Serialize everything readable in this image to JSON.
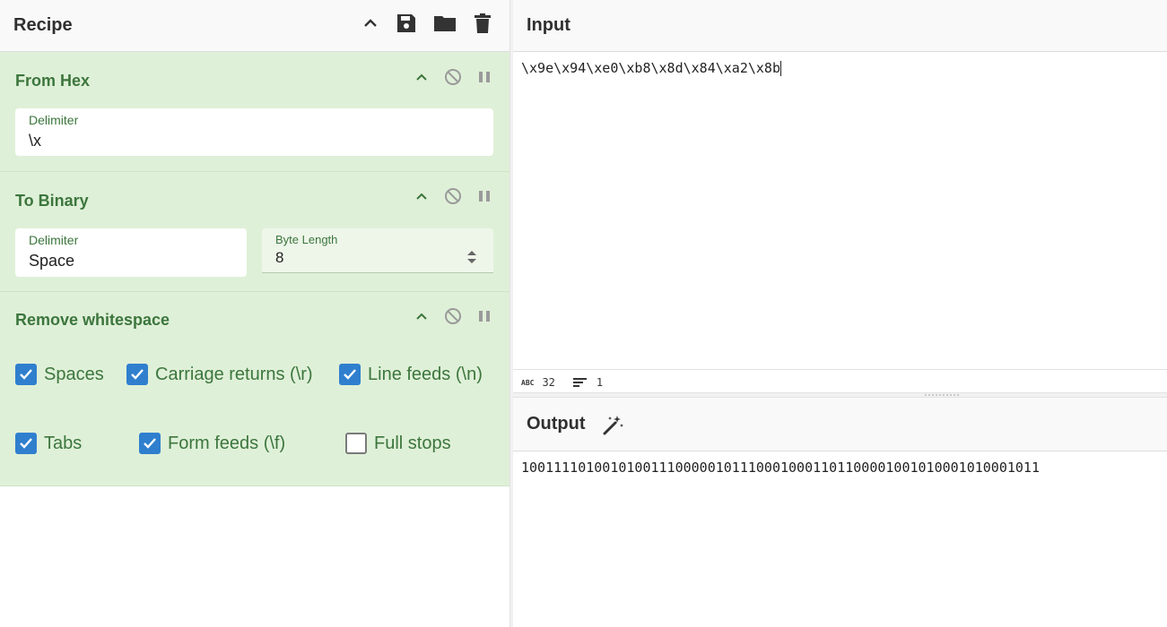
{
  "recipe": {
    "title": "Recipe",
    "tools": [
      "chevron-up-icon",
      "save-icon",
      "folder-icon",
      "trash-icon"
    ],
    "operations": [
      {
        "name": "From Hex",
        "fields": [
          {
            "label": "Delimiter",
            "value": "\\x"
          }
        ]
      },
      {
        "name": "To Binary",
        "fields": [
          {
            "label": "Delimiter",
            "value": "Space"
          },
          {
            "label": "Byte Length",
            "value": "8"
          }
        ]
      },
      {
        "name": "Remove whitespace",
        "options": [
          {
            "label": "Spaces",
            "checked": true
          },
          {
            "label": "Carriage returns (\\r)",
            "checked": true
          },
          {
            "label": "Line feeds (\\n)",
            "checked": true
          },
          {
            "label": "Tabs",
            "checked": true
          },
          {
            "label": "Form feeds (\\f)",
            "checked": true
          },
          {
            "label": "Full stops",
            "checked": false
          }
        ]
      }
    ]
  },
  "input": {
    "title": "Input",
    "text": "\\x9e\\x94\\xe0\\xb8\\x8d\\x84\\xa2\\x8b",
    "status": {
      "length_label": "ABC",
      "length": "32",
      "lines": "1"
    }
  },
  "output": {
    "title": "Output",
    "text": "1001111010010100111000001011100010001101100001001010001010001011"
  },
  "colors": {
    "accent": "#2f7fce",
    "op_bg": "#dff0d8",
    "op_text": "#3c763d"
  }
}
